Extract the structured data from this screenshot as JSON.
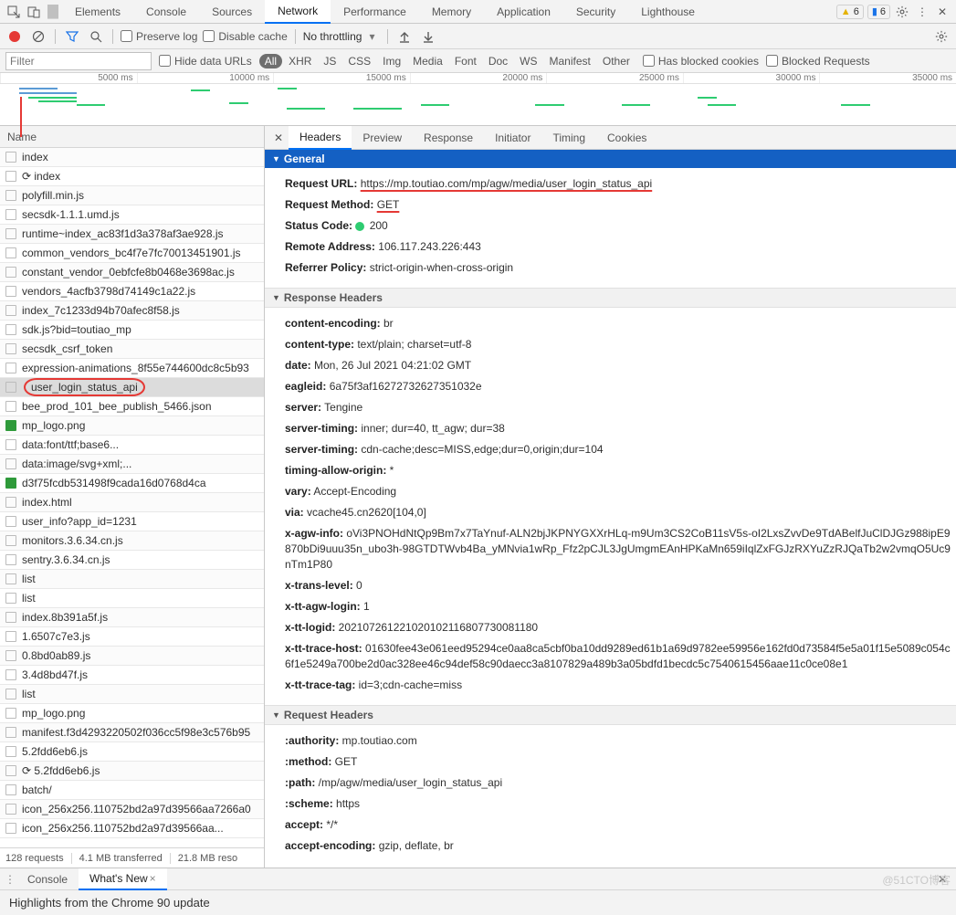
{
  "mainTabs": {
    "items": [
      "Elements",
      "Console",
      "Sources",
      "Network",
      "Performance",
      "Memory",
      "Application",
      "Security",
      "Lighthouse"
    ],
    "selected": "Network",
    "warnCount": "6",
    "msgCount": "6"
  },
  "toolbar": {
    "preserveLog": "Preserve log",
    "disableCache": "Disable cache",
    "throttling": "No throttling"
  },
  "filterBar": {
    "placeholder": "Filter",
    "hideDataUrls": "Hide data URLs",
    "chips": [
      "All",
      "XHR",
      "JS",
      "CSS",
      "Img",
      "Media",
      "Font",
      "Doc",
      "WS",
      "Manifest",
      "Other"
    ],
    "chipSelected": "All",
    "hasBlockedCookies": "Has blocked cookies",
    "blockedRequests": "Blocked Requests"
  },
  "overviewRuler": [
    "5000 ms",
    "10000 ms",
    "15000 ms",
    "20000 ms",
    "25000 ms",
    "30000 ms",
    "35000 ms"
  ],
  "reqList": {
    "header": "Name",
    "selected": "user_login_status_api",
    "rows": [
      {
        "name": "index"
      },
      {
        "name": "⟳ index"
      },
      {
        "name": "polyfill.min.js"
      },
      {
        "name": "secsdk-1.1.1.umd.js"
      },
      {
        "name": "runtime~index_ac83f1d3a378af3ae928.js"
      },
      {
        "name": "common_vendors_bc4f7e7fc70013451901.js"
      },
      {
        "name": "constant_vendor_0ebfcfe8b0468e3698ac.js"
      },
      {
        "name": "vendors_4acfb3798d74149c1a22.js"
      },
      {
        "name": "index_7c1233d94b70afec8f58.js"
      },
      {
        "name": "sdk.js?bid=toutiao_mp"
      },
      {
        "name": "secsdk_csrf_token"
      },
      {
        "name": "expression-animations_8f55e744600dc8c5b93"
      },
      {
        "name": "user_login_status_api",
        "highlighted": true
      },
      {
        "name": "bee_prod_101_bee_publish_5466.json"
      },
      {
        "name": "mp_logo.png",
        "img": true
      },
      {
        "name": "data:font/ttf;base6..."
      },
      {
        "name": "data:image/svg+xml;..."
      },
      {
        "name": "d3f75fcdb531498f9cada16d0768d4ca",
        "img": true
      },
      {
        "name": "index.html"
      },
      {
        "name": "user_info?app_id=1231"
      },
      {
        "name": "monitors.3.6.34.cn.js"
      },
      {
        "name": "sentry.3.6.34.cn.js"
      },
      {
        "name": "list"
      },
      {
        "name": "list"
      },
      {
        "name": "index.8b391a5f.js"
      },
      {
        "name": "1.6507c7e3.js"
      },
      {
        "name": "0.8bd0ab89.js"
      },
      {
        "name": "3.4d8bd47f.js"
      },
      {
        "name": "list"
      },
      {
        "name": "mp_logo.png"
      },
      {
        "name": "manifest.f3d4293220502f036cc5f98e3c576b95"
      },
      {
        "name": "5.2fdd6eb6.js"
      },
      {
        "name": "⟳ 5.2fdd6eb6.js"
      },
      {
        "name": "batch/"
      },
      {
        "name": "icon_256x256.110752bd2a97d39566aa7266a0"
      },
      {
        "name": "icon_256x256.110752bd2a97d39566aa..."
      }
    ],
    "status": {
      "a": "128 requests",
      "b": "4.1 MB transferred",
      "c": "21.8 MB reso"
    }
  },
  "detailTabs": {
    "items": [
      "Headers",
      "Preview",
      "Response",
      "Initiator",
      "Timing",
      "Cookies"
    ],
    "selected": "Headers"
  },
  "general": {
    "title": "General",
    "requestUrlLabel": "Request URL:",
    "requestUrl": "https://mp.toutiao.com/mp/agw/media/user_login_status_api",
    "requestMethodLabel": "Request Method:",
    "requestMethod": "GET",
    "statusCodeLabel": "Status Code:",
    "statusCode": "200",
    "remoteAddressLabel": "Remote Address:",
    "remoteAddress": "106.117.243.226:443",
    "referrerPolicyLabel": "Referrer Policy:",
    "referrerPolicy": "strict-origin-when-cross-origin"
  },
  "responseHeaders": {
    "title": "Response Headers",
    "items": [
      {
        "k": "content-encoding:",
        "v": "br"
      },
      {
        "k": "content-type:",
        "v": "text/plain; charset=utf-8"
      },
      {
        "k": "date:",
        "v": "Mon, 26 Jul 2021 04:21:02 GMT"
      },
      {
        "k": "eagleid:",
        "v": "6a75f3af16272732627351032e"
      },
      {
        "k": "server:",
        "v": "Tengine"
      },
      {
        "k": "server-timing:",
        "v": "inner; dur=40, tt_agw; dur=38"
      },
      {
        "k": "server-timing:",
        "v": "cdn-cache;desc=MISS,edge;dur=0,origin;dur=104"
      },
      {
        "k": "timing-allow-origin:",
        "v": "*"
      },
      {
        "k": "vary:",
        "v": "Accept-Encoding"
      },
      {
        "k": "via:",
        "v": "vcache45.cn2620[104,0]"
      },
      {
        "k": "x-agw-info:",
        "v": "oVi3PNOHdNtQp9Bm7x7TaYnuf-ALN2bjJKPNYGXXrHLq-m9Um3CS2CoB11sV5s-oI2LxsZvvDe9TdABelfJuClDJGz988ipE9870bDi9uuu35n_ubo3h-98GTDTWvb4Ba_yMNvia1wRp_Ffz2pCJL3JgUmgmEAnHPKaMn659iIqlZxFGJzRXYuZzRJQaTb2w2vmqO5Uc9nTm1P80"
      },
      {
        "k": "x-trans-level:",
        "v": "0"
      },
      {
        "k": "x-tt-agw-login:",
        "v": "1"
      },
      {
        "k": "x-tt-logid:",
        "v": "202107261221020102116807730081180"
      },
      {
        "k": "x-tt-trace-host:",
        "v": "01630fee43e061eed95294ce0aa8ca5cbf0ba10dd9289ed61b1a69d9782ee59956e162fd0d73584f5e5a01f15e5089c054c6f1e5249a700be2d0ac328ee46c94def58c90daecc3a8107829a489b3a05bdfd1becdc5c7540615456aae11c0ce08e1"
      },
      {
        "k": "x-tt-trace-tag:",
        "v": "id=3;cdn-cache=miss"
      }
    ]
  },
  "requestHeaders": {
    "title": "Request Headers",
    "items": [
      {
        "k": ":authority:",
        "v": "mp.toutiao.com"
      },
      {
        "k": ":method:",
        "v": "GET"
      },
      {
        "k": ":path:",
        "v": "/mp/agw/media/user_login_status_api"
      },
      {
        "k": ":scheme:",
        "v": "https"
      },
      {
        "k": "accept:",
        "v": "*/*"
      },
      {
        "k": "accept-encoding:",
        "v": "gzip, deflate, br"
      }
    ]
  },
  "drawer": {
    "tabs": [
      "Console",
      "What's New"
    ],
    "selected": "What's New",
    "headline": "Highlights from the Chrome 90 update"
  },
  "watermark": "@51CTO博客"
}
